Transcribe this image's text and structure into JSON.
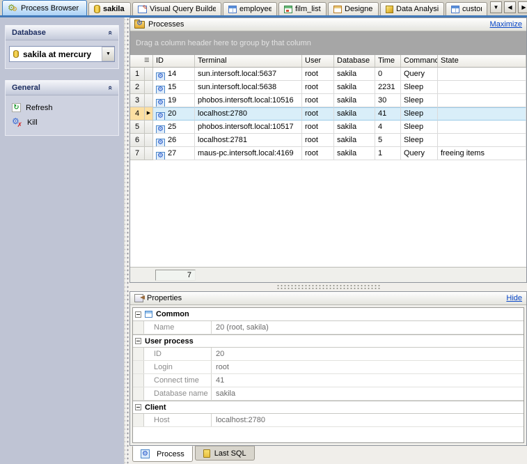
{
  "icons": {
    "gear": "⚙",
    "refresh": "↻",
    "kill_x": "✗",
    "marker": "▶",
    "corner": "≣",
    "chevron": "«",
    "dropdown": "▼",
    "prev": "◀",
    "next": "▶",
    "close": "×",
    "pencil": "✎"
  },
  "colors": {
    "accent_link": "#0645c8",
    "selection_row": "#d9eef9",
    "selection_indicator": "#fcdfa2",
    "active_tab_border": "#3a7bbf",
    "sidebar_bg": "#bfc4d4",
    "groupby_bg": "#a6a6a6",
    "tab_strip": "#4279b8"
  },
  "tabbar": {
    "tabs": [
      {
        "label": "Process Browser"
      },
      {
        "label": "sakila"
      },
      {
        "label": "Visual Query Builder"
      },
      {
        "label": "employee"
      },
      {
        "label": "film_list"
      },
      {
        "label": "Designer"
      },
      {
        "label": "Data Analysis"
      },
      {
        "label": "custor"
      }
    ]
  },
  "sidebar": {
    "database_group": {
      "title": "Database",
      "combo_value": "sakila at mercury"
    },
    "general_group": {
      "title": "General",
      "refresh_label": "Refresh",
      "kill_label": "Kill"
    }
  },
  "processes": {
    "title": "Processes",
    "maximize_label": "Maximize",
    "groupby_hint": "Drag a column header here to group by that column",
    "columns": [
      "ID",
      "Terminal",
      "User",
      "Database",
      "Time",
      "Command",
      "State"
    ],
    "rows": [
      {
        "num": "1",
        "id": "14",
        "terminal": "sun.intersoft.local:5637",
        "user": "root",
        "database": "sakila",
        "time": "0",
        "command": "Query",
        "state": ""
      },
      {
        "num": "2",
        "id": "15",
        "terminal": "sun.intersoft.local:5638",
        "user": "root",
        "database": "sakila",
        "time": "2231",
        "command": "Sleep",
        "state": ""
      },
      {
        "num": "3",
        "id": "19",
        "terminal": "phobos.intersoft.local:10516",
        "user": "root",
        "database": "sakila",
        "time": "30",
        "command": "Sleep",
        "state": ""
      },
      {
        "num": "4",
        "id": "20",
        "terminal": "localhost:2780",
        "user": "root",
        "database": "sakila",
        "time": "41",
        "command": "Sleep",
        "state": "",
        "selected": true
      },
      {
        "num": "5",
        "id": "25",
        "terminal": "phobos.intersoft.local:10517",
        "user": "root",
        "database": "sakila",
        "time": "4",
        "command": "Sleep",
        "state": ""
      },
      {
        "num": "6",
        "id": "26",
        "terminal": "localhost:2781",
        "user": "root",
        "database": "sakila",
        "time": "5",
        "command": "Sleep",
        "state": ""
      },
      {
        "num": "7",
        "id": "27",
        "terminal": "maus-pc.intersoft.local:4169",
        "user": "root",
        "database": "sakila",
        "time": "1",
        "command": "Query",
        "state": "freeing items"
      }
    ],
    "record_count": "7"
  },
  "properties": {
    "title": "Properties",
    "hide_label": "Hide",
    "groups": [
      {
        "name": "Common",
        "rows": [
          {
            "label": "Name",
            "value": "20 (root, sakila)"
          }
        ]
      },
      {
        "name": "User process",
        "rows": [
          {
            "label": "ID",
            "value": "20"
          },
          {
            "label": "Login",
            "value": "root"
          },
          {
            "label": "Connect time",
            "value": "41"
          },
          {
            "label": "Database name",
            "value": "sakila"
          }
        ]
      },
      {
        "name": "Client",
        "rows": [
          {
            "label": "Host",
            "value": "localhost:2780"
          }
        ]
      }
    ],
    "tabs": [
      {
        "label": "Process"
      },
      {
        "label": "Last SQL"
      }
    ]
  }
}
